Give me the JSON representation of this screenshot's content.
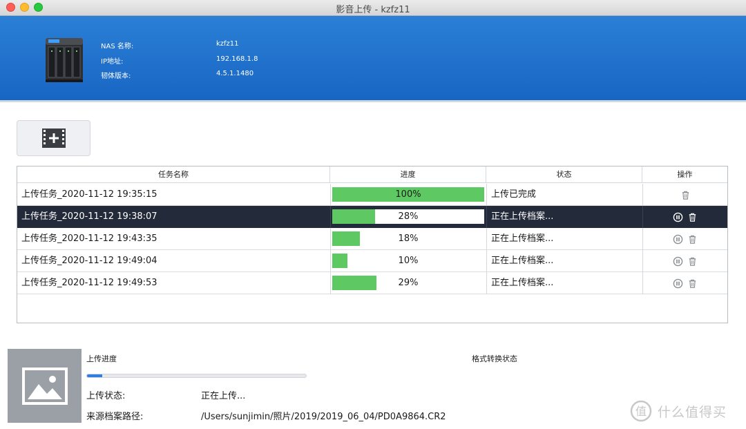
{
  "window": {
    "title": "影音上传 - kzfz11"
  },
  "nas_info": {
    "name_label": "NAS 名称:",
    "name_value": "kzfz11",
    "ip_label": "IP地址:",
    "ip_value": "192.168.1.8",
    "firmware_label": "韧体版本:",
    "firmware_value": "4.5.1.1480"
  },
  "toolbar": {
    "add_icon": "add-video-icon"
  },
  "table": {
    "headers": [
      "任务名称",
      "进度",
      "状态",
      "操作"
    ],
    "rows": [
      {
        "name": "上传任务_2020-11-12 19:35:15",
        "progress": 100,
        "progress_label": "100%",
        "status": "上传已完成",
        "actions": [
          "delete"
        ],
        "selected": false
      },
      {
        "name": "上传任务_2020-11-12 19:38:07",
        "progress": 28,
        "progress_label": "28%",
        "status": "正在上传档案...",
        "actions": [
          "pause",
          "delete"
        ],
        "selected": true
      },
      {
        "name": "上传任务_2020-11-12 19:43:35",
        "progress": 18,
        "progress_label": "18%",
        "status": "正在上传档案...",
        "actions": [
          "pause",
          "delete"
        ],
        "selected": false
      },
      {
        "name": "上传任务_2020-11-12 19:49:04",
        "progress": 10,
        "progress_label": "10%",
        "status": "正在上传档案...",
        "actions": [
          "pause",
          "delete"
        ],
        "selected": false
      },
      {
        "name": "上传任务_2020-11-12 19:49:53",
        "progress": 29,
        "progress_label": "29%",
        "status": "正在上传档案...",
        "actions": [
          "pause",
          "delete"
        ],
        "selected": false
      }
    ]
  },
  "detail": {
    "upload_progress_label": "上传进度",
    "upload_progress_value": 7,
    "convert_status_label": "格式转换状态",
    "status_label": "上传状态:",
    "status_value": "正在上传...",
    "source_label": "来源档案路径:",
    "source_value": "/Users/sunjimin/照片/2019/2019_06_04/PD0A9864.CR2"
  },
  "watermark": {
    "text": "什么值得买"
  },
  "colors": {
    "header_blue": "#1f72cd",
    "progress_green": "#5ec962",
    "selected_row": "#232a3a",
    "upload_blue": "#2f7fe0"
  }
}
